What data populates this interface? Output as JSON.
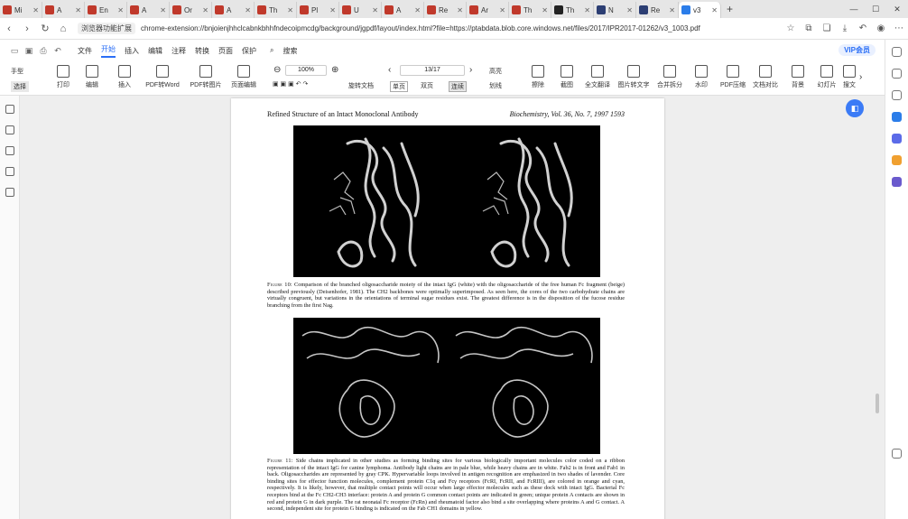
{
  "tabs": [
    {
      "title": "Mi",
      "color": "#c0392b"
    },
    {
      "title": "A",
      "color": "#c0392b"
    },
    {
      "title": "En",
      "color": "#c0392b"
    },
    {
      "title": "A",
      "color": "#c0392b"
    },
    {
      "title": "Or",
      "color": "#c0392b"
    },
    {
      "title": "A",
      "color": "#c0392b"
    },
    {
      "title": "Th",
      "color": "#c0392b"
    },
    {
      "title": "Pl",
      "color": "#c0392b"
    },
    {
      "title": "U",
      "color": "#c0392b"
    },
    {
      "title": "A",
      "color": "#c0392b"
    },
    {
      "title": "Re",
      "color": "#c0392b"
    },
    {
      "title": "Ar",
      "color": "#c0392b"
    },
    {
      "title": "Th",
      "color": "#c0392b"
    },
    {
      "title": "Th",
      "color": "#222222"
    },
    {
      "title": "N",
      "color": "#2c3e73"
    },
    {
      "title": "Re",
      "color": "#2c3e73"
    },
    {
      "title": "v3",
      "color": "#2b7de9",
      "active": true
    }
  ],
  "address": {
    "ext_label": "浏览器功能扩展",
    "url": "chrome-extension://bnjoienjhhclcabnkbhhfndecoipmcdg/background/jgpdf/layout/index.html?file=https://ptabdata.blob.core.windows.net/files/2017/IPR2017-01262/v3_1003.pdf"
  },
  "menu": {
    "file": "文件",
    "items": [
      "开始",
      "插入",
      "编辑",
      "注释",
      "转换",
      "页面",
      "保护"
    ],
    "search": "搜索",
    "vip": "VIP会员"
  },
  "ribbon": {
    "hand": "手型",
    "select": "选择",
    "print": "打印",
    "edit": "编辑",
    "insert": "插入",
    "pdf_word": "PDF转Word",
    "pdf_img": "PDF转图片",
    "page_edit": "页面编辑",
    "zoom": "100%",
    "page": "13/17",
    "rotate": "旋转文档",
    "single": "单页",
    "double": "双页",
    "continuous": "连续",
    "highlight": "高亮",
    "underline": "划线",
    "erase": "擦除",
    "screenshot": "截图",
    "translate": "全文翻译",
    "img_text": "图片转文字",
    "merge": "合并拆分",
    "watermark": "水印",
    "compress": "PDF压缩",
    "compare": "文档对比",
    "background": "背景",
    "slideshow": "幻灯片",
    "search": "搜文"
  },
  "pdf": {
    "running_left": "Refined Structure of an Intact Monoclonal Antibody",
    "running_right": "Biochemistry, Vol. 36, No. 7, 1997   1593",
    "fig10_label": "Figure 10:",
    "fig10_text": "Comparison of the branched oligosaccharide moiety of the intact IgG (white) with the oligosaccharide of the free human Fc fragment (beige) described previously (Deisenhofer, 1981). The CH2 backbones were optimally superimposed. As seen here, the cores of the two carbohydrate chains are virtually congruent, but variations in the orientations of terminal sugar residues exist. The greatest difference is in the disposition of the fucose residue branching from the first Nag.",
    "fig11_label": "Figure 11:",
    "fig11_text": "Side chains implicated in other studies as forming binding sites for various biologically important molecules color coded on a ribbon representation of the intact IgG for canine lymphoma. Antibody light chains are in pale blue, while heavy chains are in white. Fab2 is in front and Fab1 in back. Oligosaccharides are represented by gray CPK. Hypervariable loops involved in antigen recognition are emphasized in two shades of lavender. Core binding sites for effector function molecules, complement protein C1q and Fcγ receptors (FcRI, FcRII, and FcRIII), are colored in orange and cyan, respectively. It is likely, however, that multiple contact points will occur when large effector molecules such as these dock with intact IgG. Bacterial Fc receptors bind at the Fc CH2-CH3 interface: protein A and protein G common contact points are indicated in green; unique protein A contacts are shown in red and protein G in dark purple. The rat neonatal Fc receptor (FcRn) and rheumatoid factor also bind a site overlapping where proteins A and G contact. A second, independent site for protein G binding is indicated on the Fab CH1 domains in yellow."
  },
  "colors": {
    "accent": "#2b6ff6"
  }
}
